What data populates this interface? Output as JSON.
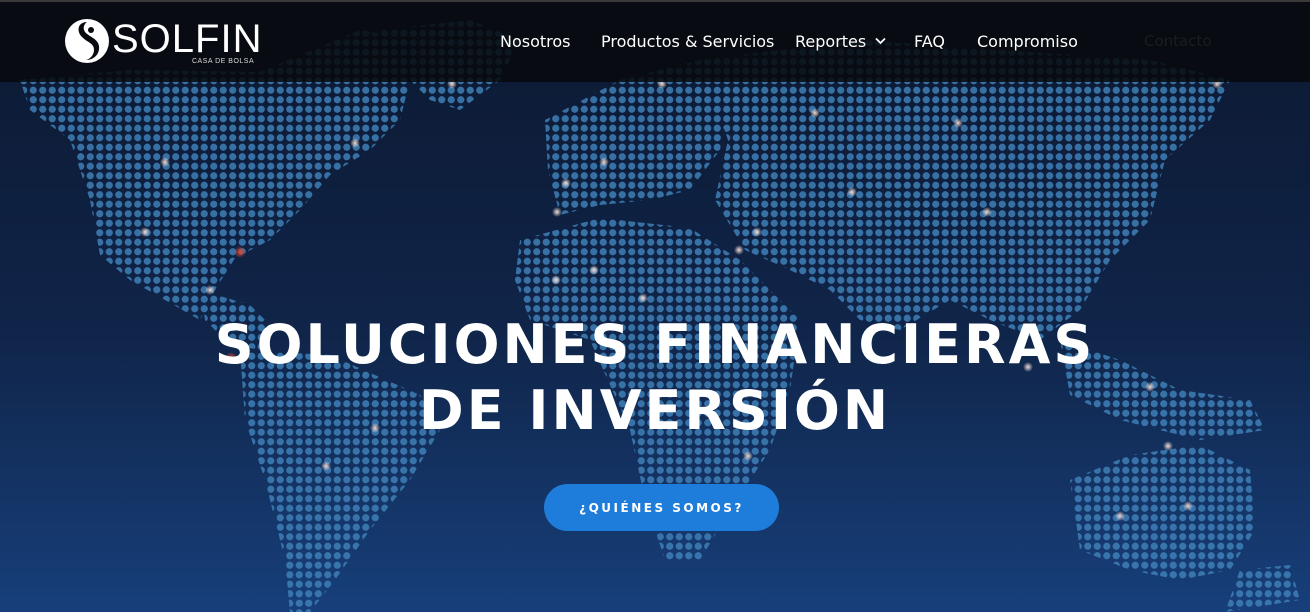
{
  "brand": {
    "name": "SOLFIN",
    "tagline": "CASA DE BOLSA"
  },
  "nav": {
    "items": [
      {
        "label": "Nosotros"
      },
      {
        "label": "Productos & Servicios"
      },
      {
        "label": "Reportes",
        "has_dropdown": true,
        "icon": "chevron-down-icon"
      },
      {
        "label": "FAQ"
      },
      {
        "label": "Compromiso"
      }
    ],
    "contact_label": "Contacto"
  },
  "hero": {
    "headline_line1": "SOLUCIONES FINANCIERAS",
    "headline_line2": "DE INVERSIÓN",
    "cta_label": "¿QUIÉNES SOMOS?",
    "background": "dotted-world-map"
  },
  "colors": {
    "navbar_bg": "#080a0e",
    "hero_top": "#0c1830",
    "hero_bottom": "#173f7a",
    "map_dot": "#3e7fb6",
    "map_highlight": "#e8c9c0",
    "map_alert": "#e0442a",
    "cta_bg": "#1e7ddb",
    "text": "#ffffff"
  }
}
